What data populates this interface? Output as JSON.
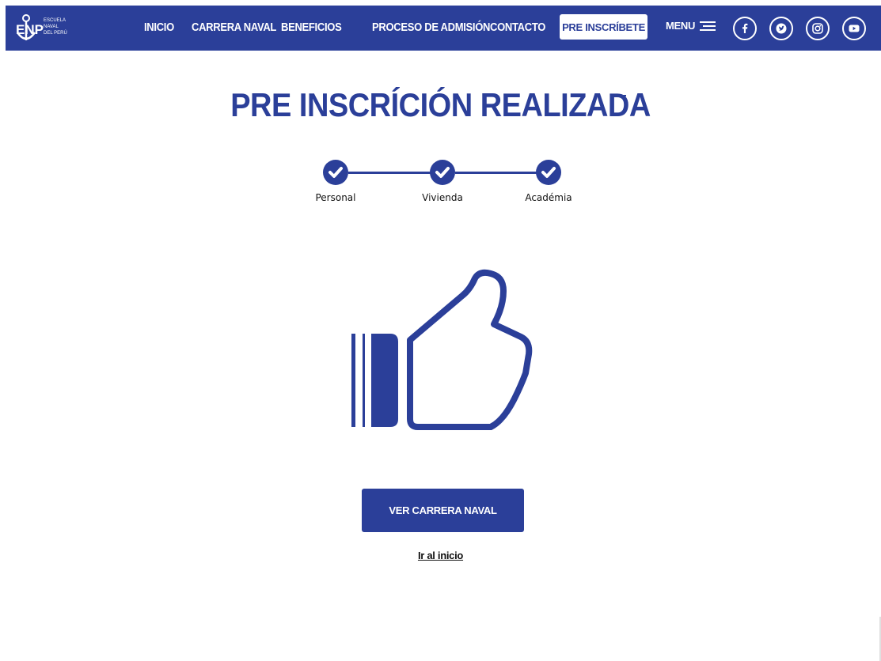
{
  "header": {
    "logo": {
      "mark": "ENP",
      "lines": [
        "ESCUELA",
        "NAVAL",
        "DEL PERÚ"
      ]
    },
    "nav": [
      {
        "label": "INICIO"
      },
      {
        "label": "CARRERA NAVAL"
      },
      {
        "label": "BENEFICIOS"
      },
      {
        "label": "PROCESO DE ADMISIÓN"
      },
      {
        "label": "CONTACTO"
      }
    ],
    "cta_label": "PRE INSCRÍBETE",
    "menu_label": "MENU",
    "social": [
      "facebook-icon",
      "twitter-icon",
      "instagram-icon",
      "youtube-icon"
    ]
  },
  "main": {
    "title": "PRE INSCRÍCIÓN REALIZADA",
    "steps": [
      {
        "label": "Personal",
        "status": "completed"
      },
      {
        "label": "Vivienda",
        "status": "completed"
      },
      {
        "label": "Académia",
        "status": "completed"
      }
    ],
    "illustration": "thumbs-up-icon",
    "primary_button": "VER CARRERA NAVAL",
    "secondary_link": "Ir al inicio"
  },
  "colors": {
    "brand": "#2b3f99",
    "background": "#ffffff",
    "text": "#111111"
  }
}
